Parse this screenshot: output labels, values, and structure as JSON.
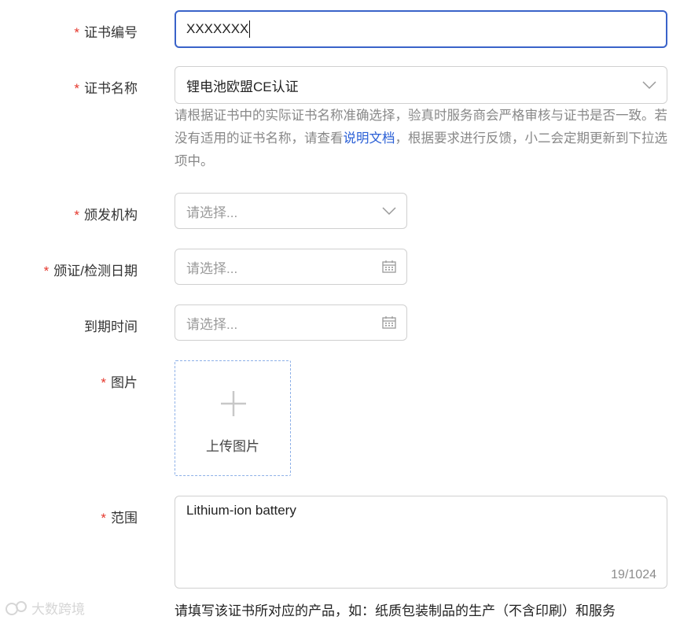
{
  "form": {
    "cert_no": {
      "label": "证书编号",
      "required": true,
      "value": "XXXXXXX"
    },
    "cert_name": {
      "label": "证书名称",
      "required": true,
      "value": "锂电池欧盟CE认证",
      "hint_before": "请根据证书中的实际证书名称准确选择，验真时服务商会严格审核与证书是否一致。若没有适用的证书名称，请查看",
      "hint_link": "说明文档",
      "hint_after": "，根据要求进行反馈，小二会定期更新到下拉选项中。"
    },
    "issuer": {
      "label": "颁发机构",
      "required": true,
      "placeholder": "请选择..."
    },
    "issue_date": {
      "label": "颁证/检测日期",
      "required": true,
      "placeholder": "请选择..."
    },
    "expire_date": {
      "label": "到期时间",
      "required": false,
      "placeholder": "请选择..."
    },
    "image": {
      "label": "图片",
      "required": true,
      "upload_label": "上传图片"
    },
    "scope": {
      "label": "范围",
      "required": true,
      "value": "Lithium-ion battery",
      "counter": "19/1024",
      "hint": "请填写该证书所对应的产品，如：纸质包装制品的生产（不含印刷）和服务"
    },
    "required_mark": "*"
  },
  "watermark": {
    "text": "大数跨境"
  },
  "colors": {
    "required": "#e5372c",
    "focus_border": "#3a63c9",
    "link": "#2a5fd6",
    "upload_border": "#8db0e8"
  }
}
